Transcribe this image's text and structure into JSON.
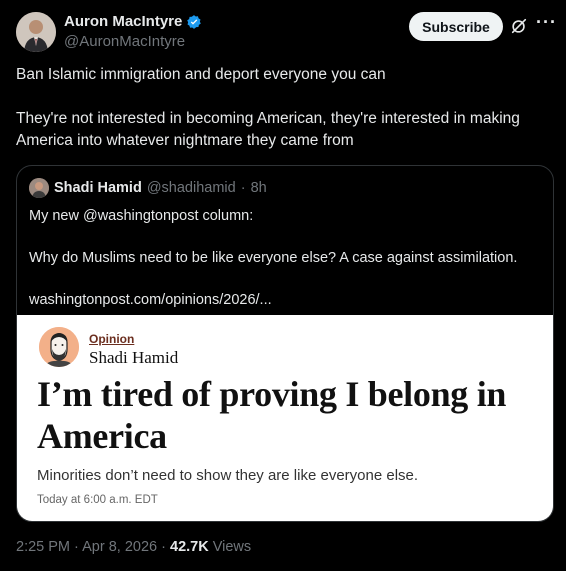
{
  "post": {
    "author_name": "Auron MacIntyre",
    "author_handle": "@AuronMacIntyre",
    "subscribe_label": "Subscribe",
    "more_icon": "more-icon",
    "paragraphs": [
      "Ban Islamic immigration and deport everyone you can",
      "They're not interested in becoming American, they're interested in making America into whatever nightmare they came from"
    ],
    "time": "2:25 PM",
    "date": "Apr 8, 2026",
    "views_count": "42.7K",
    "views_label": "Views",
    "separator": "·"
  },
  "quote": {
    "author_name": "Shadi Hamid",
    "author_handle": "@shadihamid",
    "separator": "·",
    "age": "8h",
    "paragraphs": [
      "My new @washingtonpost column:",
      "Why do Muslims need to be like everyone else? A case against assimilation.",
      "washingtonpost.com/opinions/2026/..."
    ],
    "card": {
      "section": "Opinion",
      "author": "Shadi Hamid",
      "headline": "I’m tired of proving I belong in America",
      "subheadline": "Minorities don’t need to show they are like everyone else.",
      "dateline": "Today at 6:00 a.m. EDT"
    }
  },
  "colors": {
    "verified": "#1d9bf0",
    "background": "#000000",
    "muted": "#71767b"
  }
}
